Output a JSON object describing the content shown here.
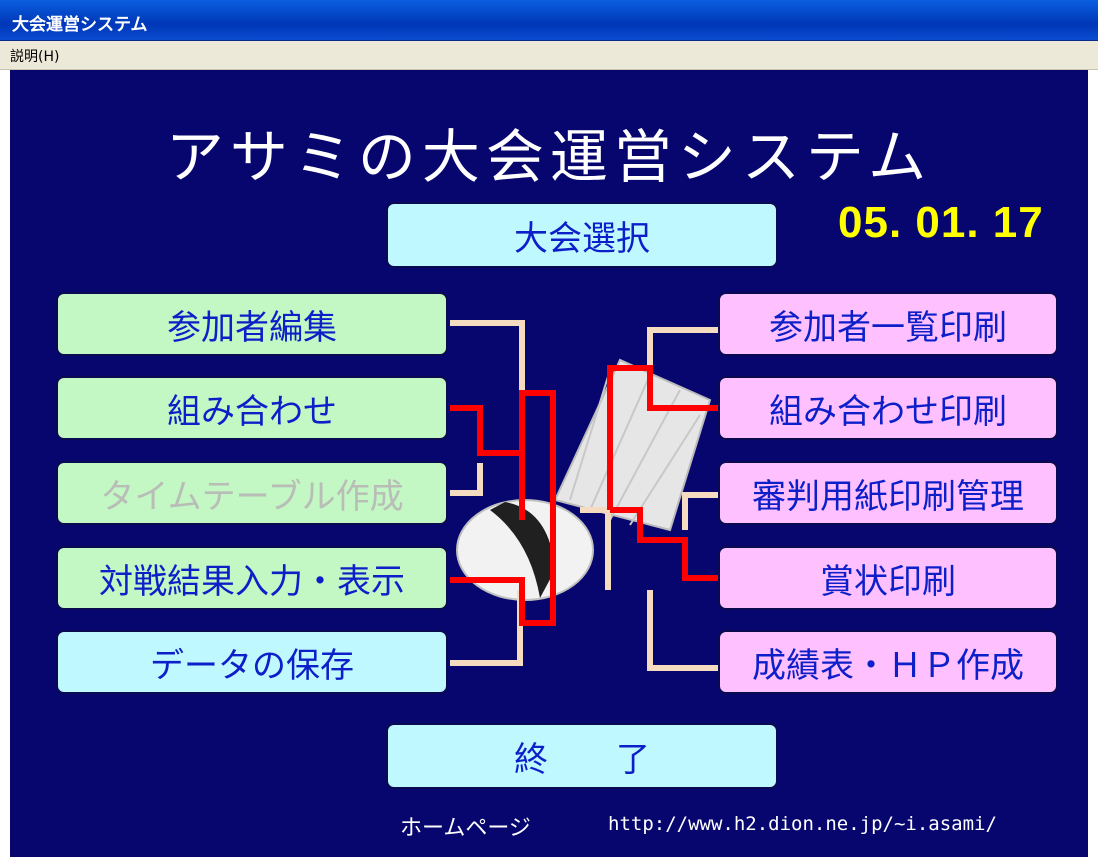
{
  "window": {
    "title": "大会運営システム"
  },
  "menu": {
    "help": "説明(H)"
  },
  "app_title": "アサミの大会運営システム",
  "date": "05. 01. 17",
  "buttons": {
    "tournament_select": "大会選択",
    "participant_edit": "参加者編集",
    "matchup": "組み合わせ",
    "timetable": "タイムテーブル作成",
    "result_input": "対戦結果入力・表示",
    "save_data": "データの保存",
    "participant_print": "参加者一覧印刷",
    "matchup_print": "組み合わせ印刷",
    "referee_sheet": "審判用紙印刷管理",
    "award_print": "賞状印刷",
    "grade_hp": "成績表・ＨＰ作成",
    "exit": "終　　了"
  },
  "footer": {
    "homepage_label": "ホームページ",
    "url": "http://www.h2.dion.ne.jp/~i.asami/"
  },
  "colors": {
    "background": "#06066e",
    "title_text": "#ffffff",
    "date_text": "#ffff00",
    "button_text": "#0c1fc8",
    "cyan_button": "#bff8ff",
    "green_button": "#c3f7c3",
    "pink_button": "#ffc0ff",
    "bracket_red": "#ff0000",
    "bracket_cream": "#f5dcc0"
  },
  "icons": {
    "center_image": "shuttlecock-image"
  }
}
